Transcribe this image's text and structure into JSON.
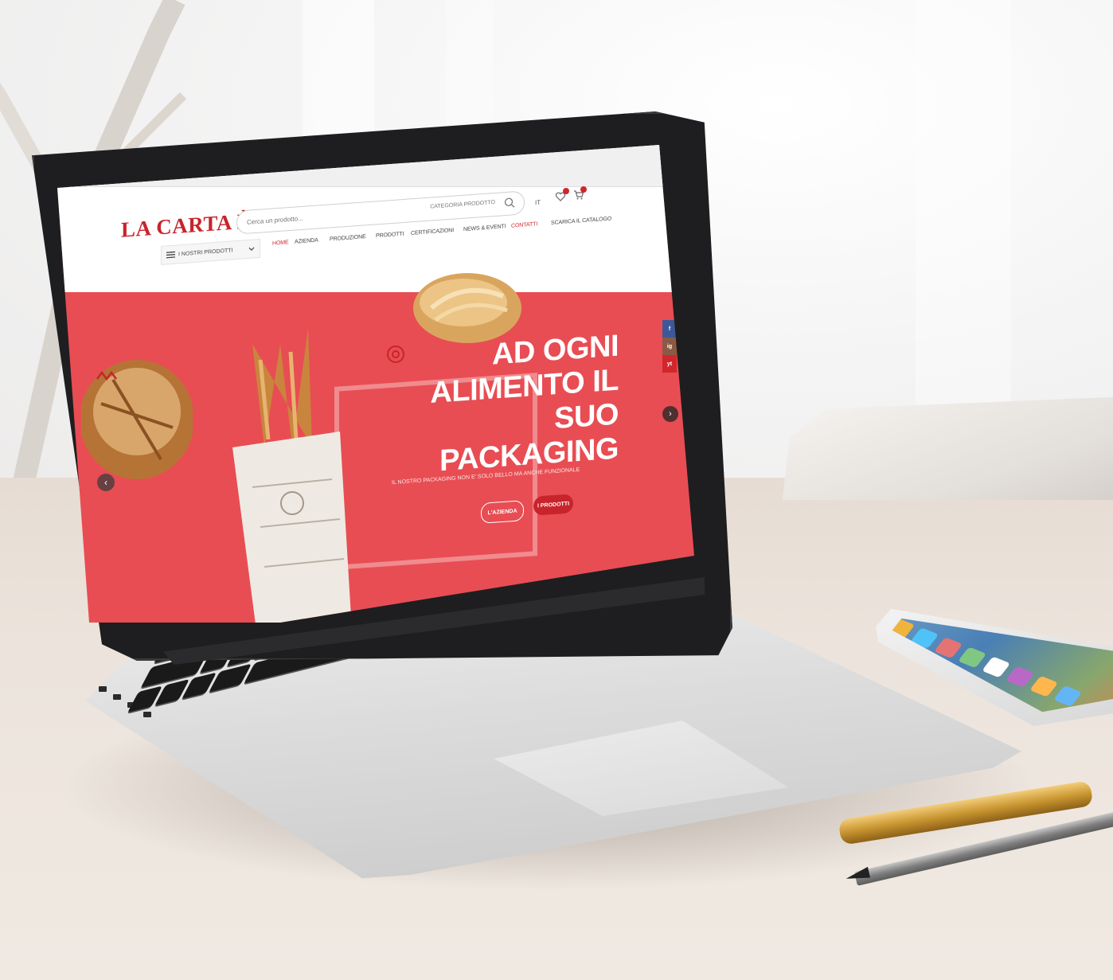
{
  "site": {
    "logo_text": "LA CARTA È",
    "search": {
      "placeholder": "Cerca un prodotto...",
      "category_label": "CATEGORIA PRODOTTO"
    },
    "language": "IT",
    "nav": {
      "category_menu_label": "I NOSTRI PRODOTTI",
      "items": [
        "HOME",
        "AZIENDA",
        "PRODUZIONE",
        "PRODOTTI",
        "CERTIFICAZIONI",
        "NEWS & EVENTI",
        "CONTATTI",
        "SCARICA IL CATALOGO"
      ]
    },
    "hero": {
      "title_lines": [
        "AD OGNI",
        "ALIMENTO IL",
        "SUO PACKAGING"
      ],
      "subtitle": "IL NOSTRO PACKAGING NON E' SOLO BELLO MA ANCHE FUNZIONALE",
      "button_azienda": "L'AZIENDA",
      "button_prodotti": "I PRODOTTI"
    },
    "social_labels": [
      "f",
      "ig",
      "yt"
    ]
  },
  "colors": {
    "brand_red": "#e84d53",
    "logo_red": "#c8242b"
  },
  "icons": [
    "search-icon",
    "heart-icon",
    "cart-icon",
    "hamburger-icon",
    "chevron-left-icon",
    "chevron-right-icon",
    "phone-icon",
    "download-icon"
  ]
}
